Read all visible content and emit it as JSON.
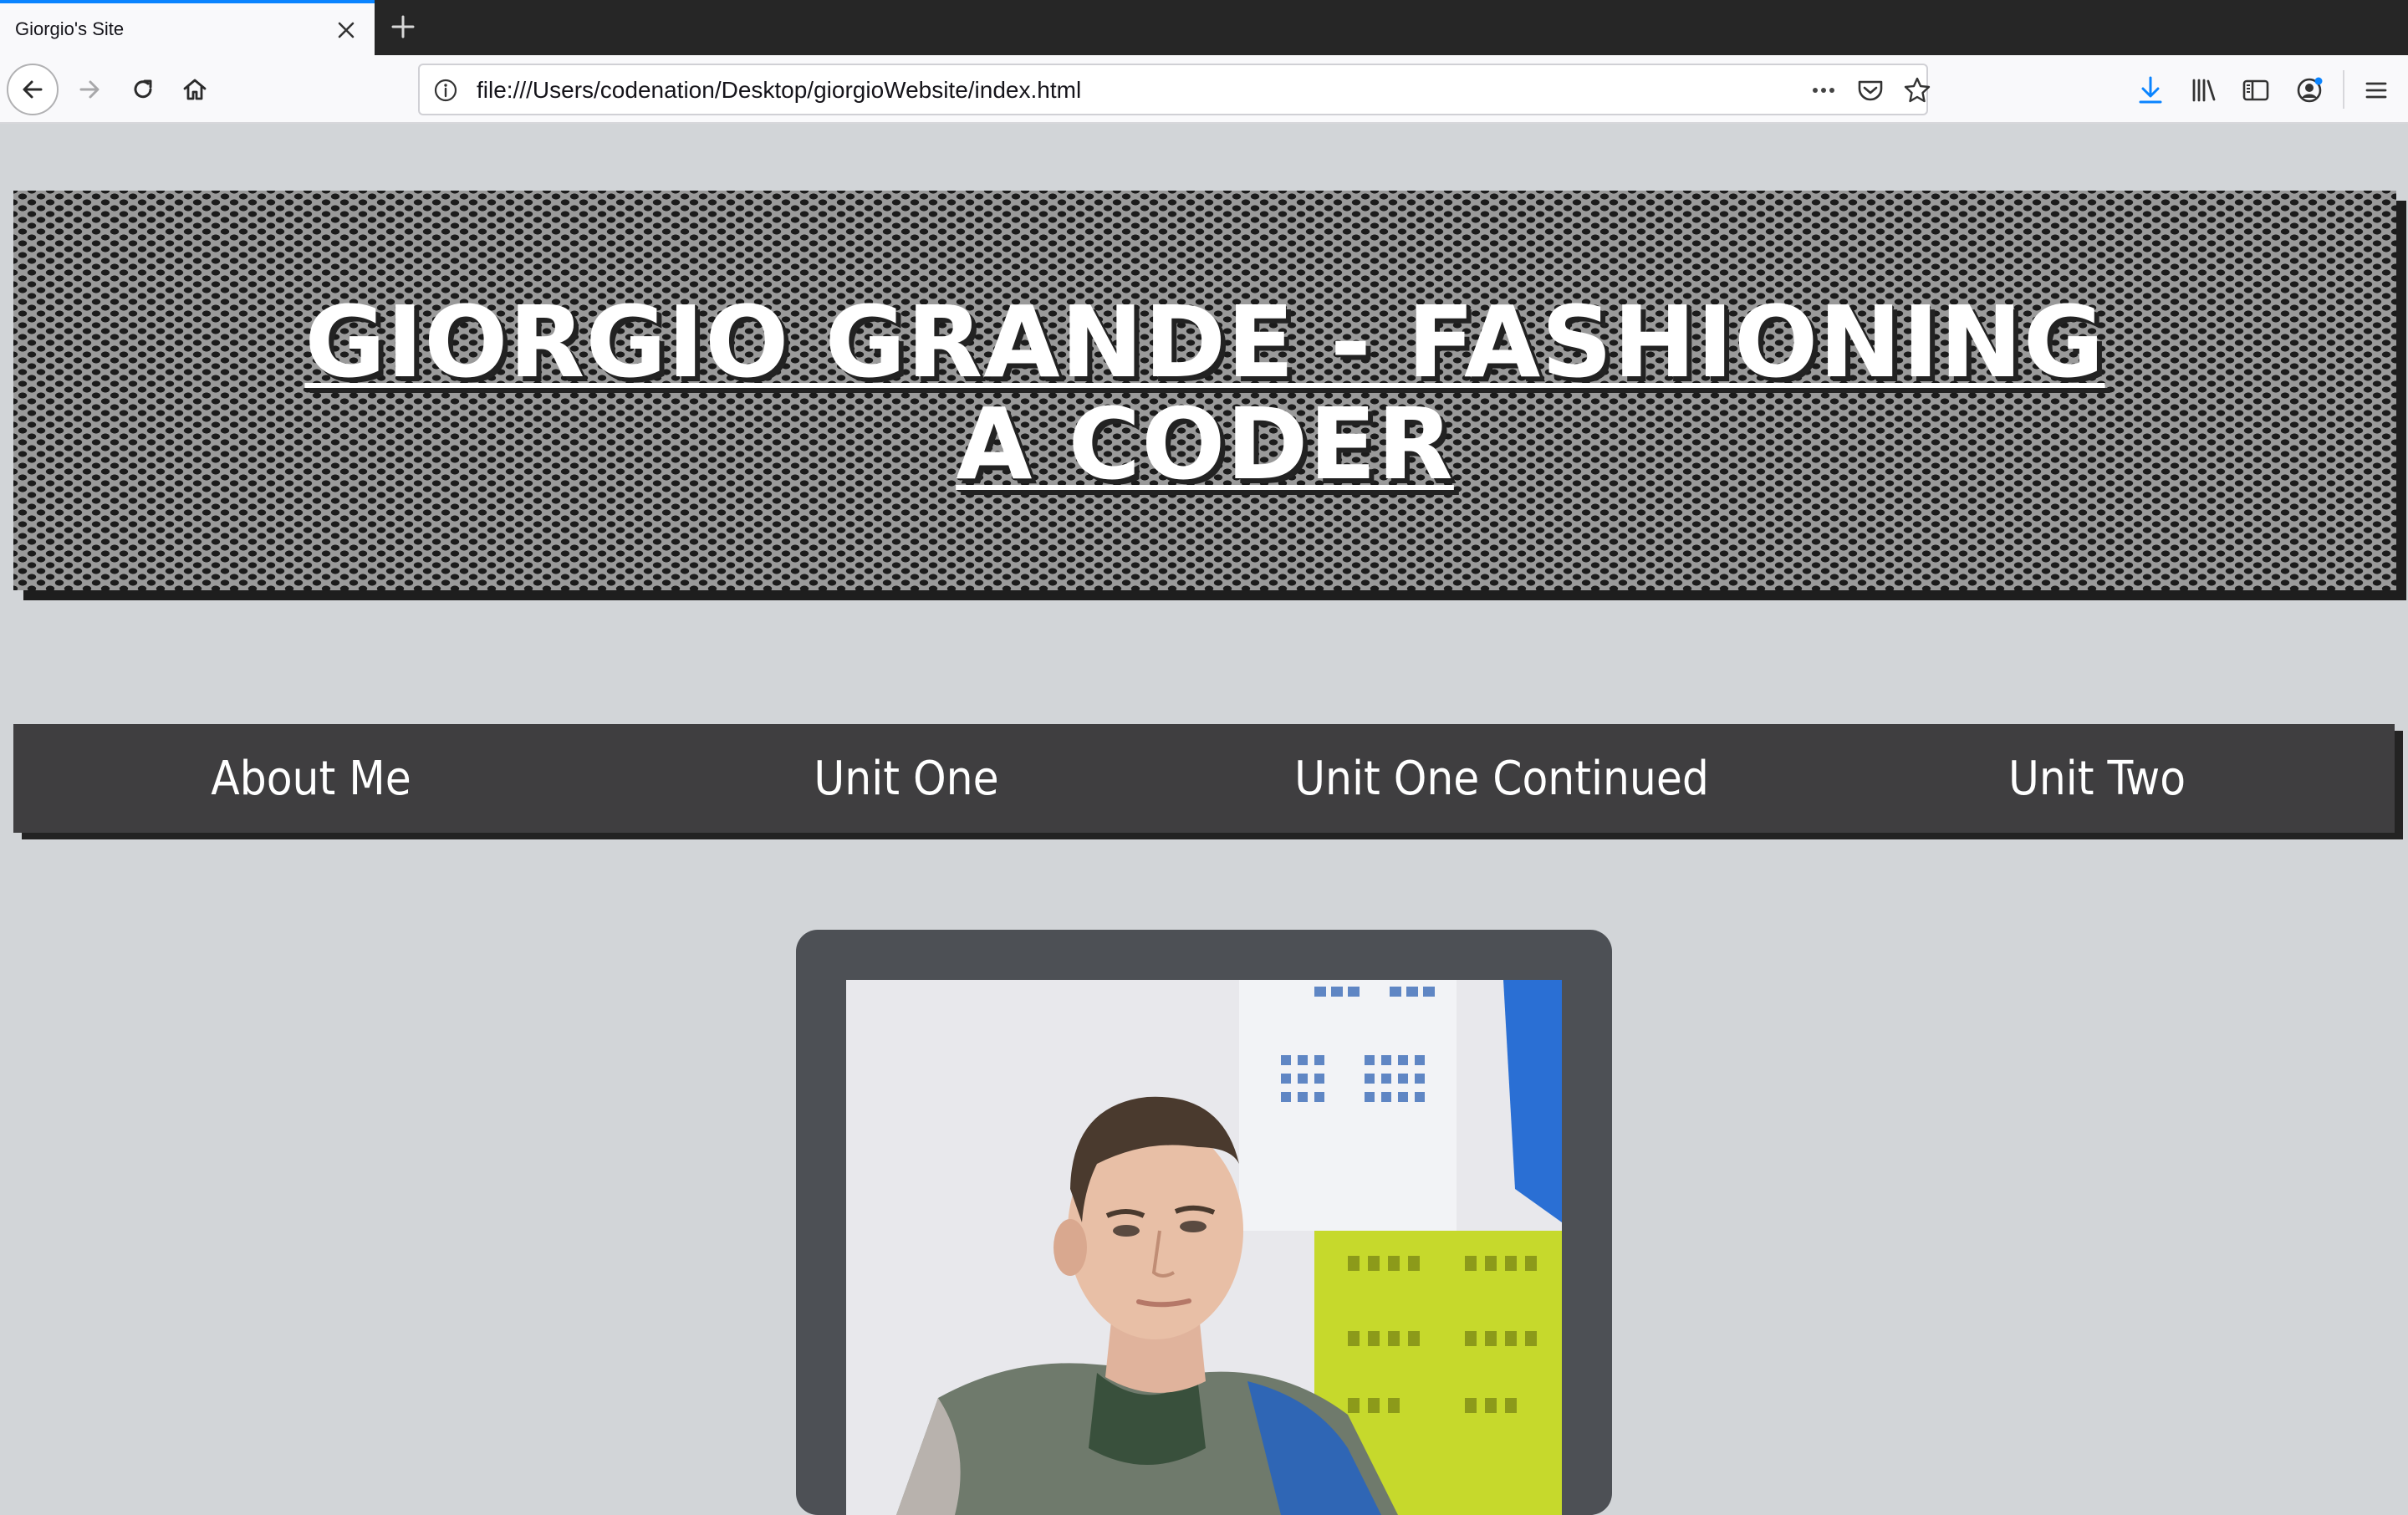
{
  "browser": {
    "tab_title": "Giorgio's Site",
    "url": "file:///Users/codenation/Desktop/giorgioWebsite/index.html",
    "colors": {
      "accent": "#0a84ff",
      "download": "#0a84ff"
    }
  },
  "site": {
    "title": "GIORGIO GRANDE - FASHIONING A CODER",
    "menu": [
      "About Me",
      "Unit One",
      "Unit One Continued",
      "Unit Two"
    ],
    "colors": {
      "background": "#d2d5d8",
      "menu": "#3f3e40",
      "photo_frame": "#4d5055"
    }
  }
}
